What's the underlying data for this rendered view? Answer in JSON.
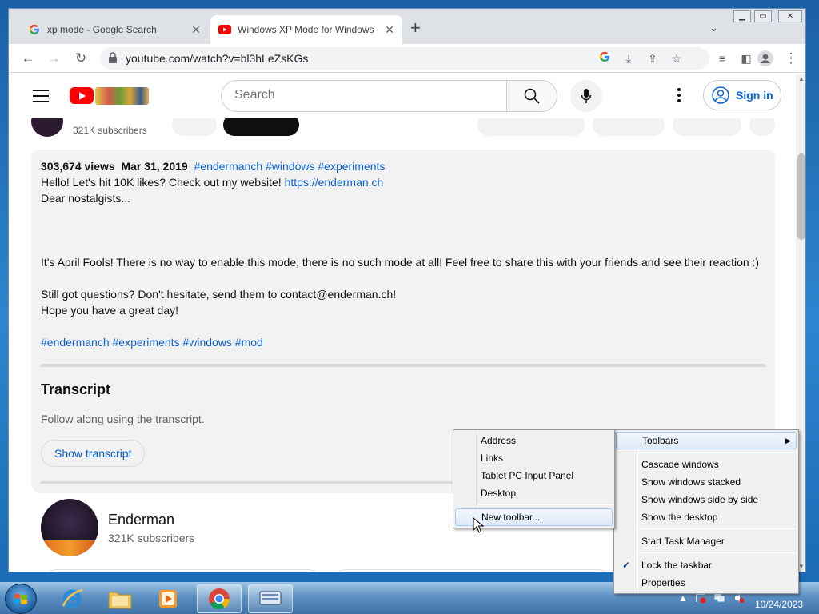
{
  "browser": {
    "tabs": [
      {
        "title": "xp mode - Google Search",
        "active": false
      },
      {
        "title": "Windows XP Mode for Windows",
        "active": true
      }
    ],
    "url": "youtube.com/watch?v=bl3hLeZsKGs"
  },
  "youtube": {
    "search_placeholder": "Search",
    "sign_in_label": "Sign in",
    "header_partial_subscribers": "321K subscribers",
    "description": {
      "views": "303,674 views",
      "date": "Mar 31, 2019",
      "tags_top": "#endermanch #windows #experiments",
      "line1_text": "Hello! Let's hit 10K likes? Check out my website! ",
      "line1_link": "https://enderman.ch",
      "line2": "Dear nostalgists...",
      "line3": "It's April Fools! There is no way to enable this mode, there is no such mode at all! Feel free to share this with your friends and see their reaction :)",
      "line4": "Still got questions? Don't hesitate, send them to contact@enderman.ch!",
      "line5": "Hope you have a great day!",
      "tags_bottom": "#endermanch #experiments #windows #mod"
    },
    "transcript": {
      "title": "Transcript",
      "subtitle": "Follow along using the transcript.",
      "button": "Show transcript"
    },
    "channel": {
      "name": "Enderman",
      "subscribers": "321K subscribers"
    }
  },
  "context_menu": {
    "main_items": [
      {
        "label": "Toolbars",
        "has_submenu": true,
        "highlighted": true
      },
      {
        "label": "Cascade windows"
      },
      {
        "label": "Show windows stacked"
      },
      {
        "label": "Show windows side by side"
      },
      {
        "label": "Show the desktop"
      },
      {
        "label": "Start Task Manager"
      },
      {
        "label": "Lock the taskbar",
        "checked": true
      },
      {
        "label": "Properties"
      }
    ],
    "toolbars_submenu": [
      {
        "label": "Address"
      },
      {
        "label": "Links"
      },
      {
        "label": "Tablet PC Input Panel"
      },
      {
        "label": "Desktop"
      },
      {
        "label": "New toolbar...",
        "highlighted": true
      }
    ]
  },
  "taskbar": {
    "date": "10/24/2023",
    "pinned": [
      {
        "icon": "internet-explorer-icon"
      },
      {
        "icon": "file-explorer-icon"
      },
      {
        "icon": "media-player-icon"
      },
      {
        "icon": "chrome-icon",
        "open": true
      },
      {
        "icon": "on-screen-keyboard-icon",
        "open": true
      }
    ]
  },
  "colors": {
    "link": "#065fd4",
    "youtube_red": "#ff0000",
    "menu_highlight_border": "#a8caf0"
  }
}
